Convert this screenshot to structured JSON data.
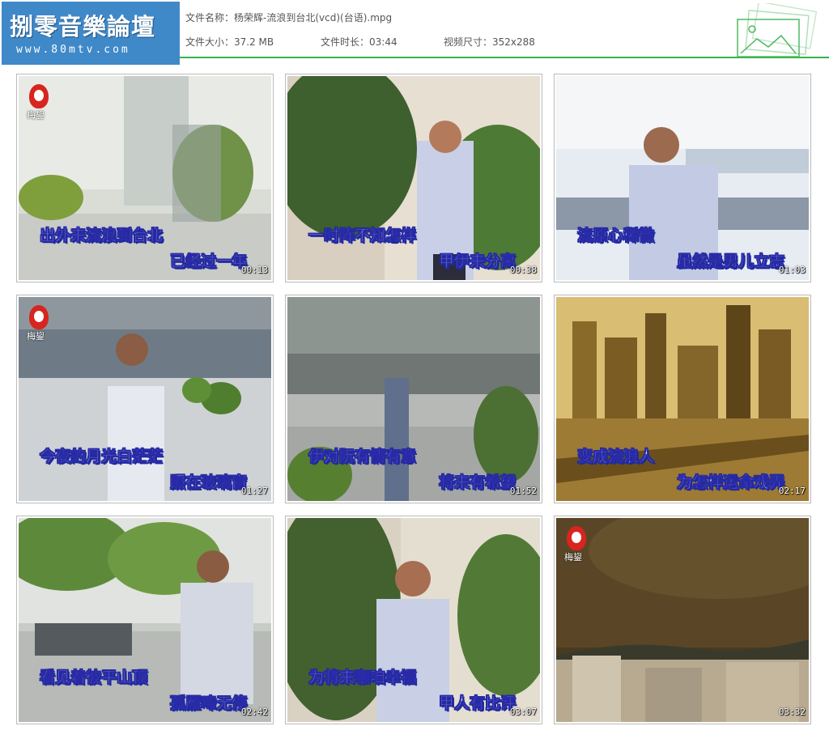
{
  "header": {
    "logo_main": "捌零音樂論壇",
    "logo_sub": "www.80mtv.com",
    "file_name": "文件名称：杨荣辉-流浪到台北(vcd)(台语).mpg",
    "file_size": "文件大小：37.2 MB",
    "duration": "文件时长：03:44",
    "dimensions": "视频尺寸：352x288",
    "accent_color": "#34b34a"
  },
  "brand_icon": {
    "name": "meilun-logo-icon",
    "label": "梅鋆"
  },
  "thumbnails": [
    {
      "line1": "出外来流浪到台北",
      "line2": "已经过一年",
      "time": "00:13",
      "brand": true
    },
    {
      "line1": "一时阵不知怎样",
      "line2": "甲伊来分离",
      "time": "00:38",
      "brand": false
    },
    {
      "line1": "流原心稀微",
      "line2": "虽然是男儿立志",
      "time": "01:03",
      "brand": false
    },
    {
      "line1": "今夜的月光白茫茫",
      "line2": "照在玻璃窗",
      "time": "01:27",
      "brand": true
    },
    {
      "line1": "伊对阮有情有意",
      "line2": "将来有希望",
      "time": "01:52",
      "brand": false
    },
    {
      "line1": "变成流浪人",
      "line2": "为怎样运命戏弄",
      "time": "02:17",
      "brand": false
    },
    {
      "line1": "看见着彼平山顶",
      "line2": "孤雁啼无停",
      "time": "02:42",
      "brand": false
    },
    {
      "line1": "为将来咖咱幸福",
      "line2": "甲人有比评",
      "time": "03:07",
      "brand": false
    },
    {
      "line1": "",
      "line2": "",
      "time": "03:32",
      "brand": true
    }
  ]
}
